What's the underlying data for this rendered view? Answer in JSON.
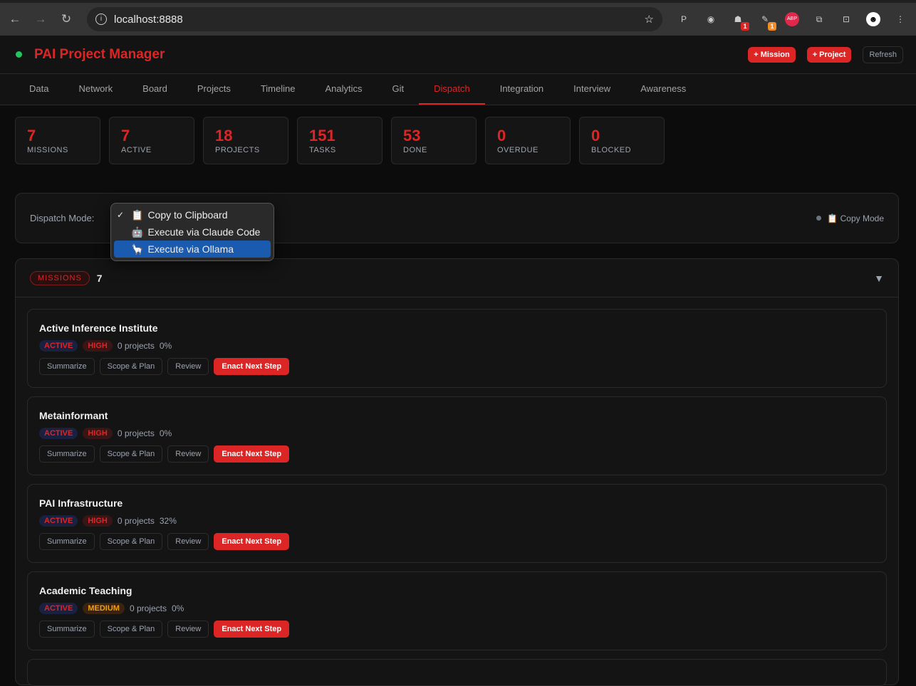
{
  "browser": {
    "url": "localhost:8888",
    "ext_badges": [
      "1",
      "1"
    ],
    "abp": "ABP"
  },
  "header": {
    "title": "PAI Project Manager",
    "add_mission": "+ Mission",
    "add_project": "+ Project",
    "refresh": "Refresh"
  },
  "nav": {
    "tabs": [
      "Data",
      "Network",
      "Board",
      "Projects",
      "Timeline",
      "Analytics",
      "Git",
      "Dispatch",
      "Integration",
      "Interview",
      "Awareness"
    ],
    "active": "Dispatch"
  },
  "stats": [
    {
      "value": "7",
      "label": "MISSIONS"
    },
    {
      "value": "7",
      "label": "ACTIVE"
    },
    {
      "value": "18",
      "label": "PROJECTS"
    },
    {
      "value": "151",
      "label": "TASKS"
    },
    {
      "value": "53",
      "label": "DONE"
    },
    {
      "value": "0",
      "label": "OVERDUE"
    },
    {
      "value": "0",
      "label": "BLOCKED"
    }
  ],
  "dispatch": {
    "label": "Dispatch Mode:",
    "status": "📋 Copy Mode",
    "options": [
      {
        "check": "✓",
        "icon": "📋",
        "label": "Copy to Clipboard"
      },
      {
        "check": "",
        "icon": "🤖",
        "label": "Execute via Claude Code"
      },
      {
        "check": "",
        "icon": "🦙",
        "label": "Execute via Ollama"
      }
    ],
    "highlighted": 2
  },
  "missions": {
    "label": "MISSIONS",
    "count": "7",
    "caret": "▼",
    "actions": [
      "Summarize",
      "Scope & Plan",
      "Review",
      "Enact Next Step"
    ],
    "items": [
      {
        "name": "Active Inference Institute",
        "status": "ACTIVE",
        "priority": "HIGH",
        "projects": "0 projects",
        "progress": "0%"
      },
      {
        "name": "Metainformant",
        "status": "ACTIVE",
        "priority": "HIGH",
        "projects": "0 projects",
        "progress": "0%"
      },
      {
        "name": "PAI Infrastructure",
        "status": "ACTIVE",
        "priority": "HIGH",
        "projects": "0 projects",
        "progress": "32%"
      },
      {
        "name": "Academic Teaching",
        "status": "ACTIVE",
        "priority": "MEDIUM",
        "projects": "0 projects",
        "progress": "0%"
      }
    ]
  }
}
